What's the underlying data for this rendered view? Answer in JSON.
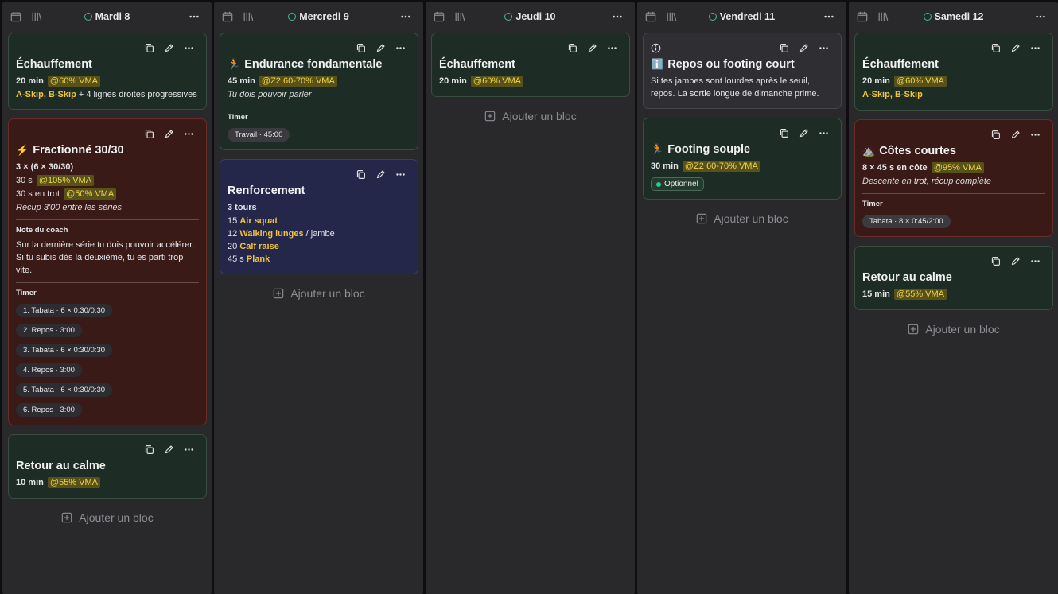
{
  "add_label": "Ajouter un bloc",
  "columns": [
    {
      "day": "Mardi 8",
      "cards": [
        {
          "title": "Échauffement",
          "dur": "20 min",
          "chip": "@60% VMA",
          "drill_a": "A-Skip, B-Skip",
          "drill_rest": " + 4 lignes droites progressives"
        },
        {
          "emoji": "⚡",
          "title": "Fractionné 30/30",
          "head": "3 × (6 × 30/30)",
          "l1": "30 s",
          "l1chip": "@105% VMA",
          "l2": "30 s en trot",
          "l2chip": "@50% VMA",
          "italic": "Récup 3'00 entre les séries",
          "note_label": "Note du coach",
          "note": "Sur la dernière série tu dois pouvoir accélérer. Si tu subis dès la deuxième, tu es parti trop vite.",
          "timer_label": "Timer",
          "timers": [
            "1. Tabata · 6 × 0:30/0:30",
            "2. Repos · 3:00",
            "3. Tabata · 6 × 0:30/0:30",
            "4. Repos · 3:00",
            "5. Tabata · 6 × 0:30/0:30",
            "6. Repos · 3:00"
          ]
        },
        {
          "title": "Retour au calme",
          "dur": "10 min",
          "chip": "@55% VMA"
        }
      ]
    },
    {
      "day": "Mercredi 9",
      "cards": [
        {
          "emoji": "🏃",
          "title": "Endurance fondamentale",
          "dur": "45 min",
          "chip": "@Z2 60-70% VMA",
          "italic": "Tu dois pouvoir parler",
          "timer_label": "Timer",
          "timer": "Travail · 45:00"
        },
        {
          "title": "Renforcement",
          "head": "3 tours",
          "ex": [
            {
              "n": "15",
              "name": "Air squat",
              "suffix": ""
            },
            {
              "n": "12",
              "name": "Walking lunges",
              "suffix": " / jambe"
            },
            {
              "n": "20",
              "name": "Calf raise",
              "suffix": ""
            },
            {
              "n": "45 s",
              "name": "Plank",
              "suffix": ""
            }
          ]
        }
      ]
    },
    {
      "day": "Jeudi 10",
      "cards": [
        {
          "title": "Échauffement",
          "dur": "20 min",
          "chip": "@60% VMA"
        }
      ]
    },
    {
      "day": "Vendredi 11",
      "cards": [
        {
          "emoji": "ℹ️",
          "title": "Repos ou footing court",
          "text": "Si tes jambes sont lourdes après le seuil, repos. La sortie longue de dimanche prime."
        },
        {
          "emoji": "🏃",
          "title": "Footing souple",
          "dur": "30 min",
          "chip": "@Z2 60-70% VMA",
          "badge": "Optionnel"
        }
      ]
    },
    {
      "day": "Samedi 12",
      "cards": [
        {
          "title": "Échauffement",
          "dur": "20 min",
          "chip": "@60% VMA",
          "drill_a": "A-Skip, B-Skip"
        },
        {
          "emoji": "⛰️",
          "title": "Côtes courtes",
          "head": "8 × 45 s en côte",
          "chip": "@95% VMA",
          "italic": "Descente en trot, récup complète",
          "timer_label": "Timer",
          "timer": "Tabata · 8 × 0:45/2:00"
        },
        {
          "title": "Retour au calme",
          "dur": "15 min",
          "chip": "@55% VMA"
        }
      ]
    }
  ]
}
